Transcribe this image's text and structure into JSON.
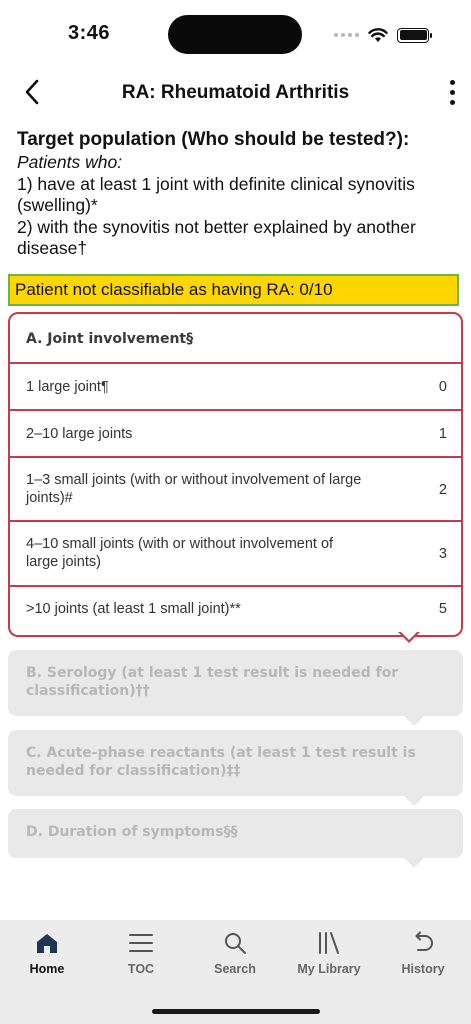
{
  "status_bar": {
    "time": "3:46"
  },
  "nav": {
    "back_icon": "chevron-left-icon",
    "title": "RA: Rheumatoid Arthritis",
    "more_icon": "more-vertical-icon"
  },
  "intro": {
    "heading": "Target population (Who should be tested?):",
    "subheading": "Patients who:",
    "item1": "1) have at least 1 joint with definite clinical synovitis (swelling)*",
    "item2": "2) with the synovitis not better explained by another disease†"
  },
  "score_banner": {
    "text": "Patient not classifiable as having RA: 0/10",
    "color": "#ffd600",
    "border_color": "#6cb34a"
  },
  "joint_card": {
    "title": "A. Joint involvement§",
    "accent": "#c8394a",
    "rows": [
      {
        "label": "1 large joint¶",
        "points": "0"
      },
      {
        "label": "2–10 large joints",
        "points": "1"
      },
      {
        "label": "1–3 small joints (with or without involvement of large joints)#",
        "points": "2"
      },
      {
        "label": "4–10 small joints (with or without involvement of large joints)",
        "points": "3"
      },
      {
        "label": ">10 joints (at least 1 small joint)**",
        "points": "5"
      }
    ]
  },
  "sections": {
    "serology": "B. Serology (at least 1 test result is needed for classification)††",
    "acute_phase": "C. Acute-phase reactants (at least 1 test result is needed for classification)‡‡",
    "duration": "D. Duration of symptoms§§"
  },
  "tabbar": {
    "tabs": [
      {
        "label": "Home",
        "icon": "home-icon",
        "active": true
      },
      {
        "label": "TOC",
        "icon": "list-icon",
        "active": false
      },
      {
        "label": "Search",
        "icon": "search-icon",
        "active": false
      },
      {
        "label": "My Library",
        "icon": "library-icon",
        "active": false
      },
      {
        "label": "History",
        "icon": "history-icon",
        "active": false
      }
    ]
  }
}
